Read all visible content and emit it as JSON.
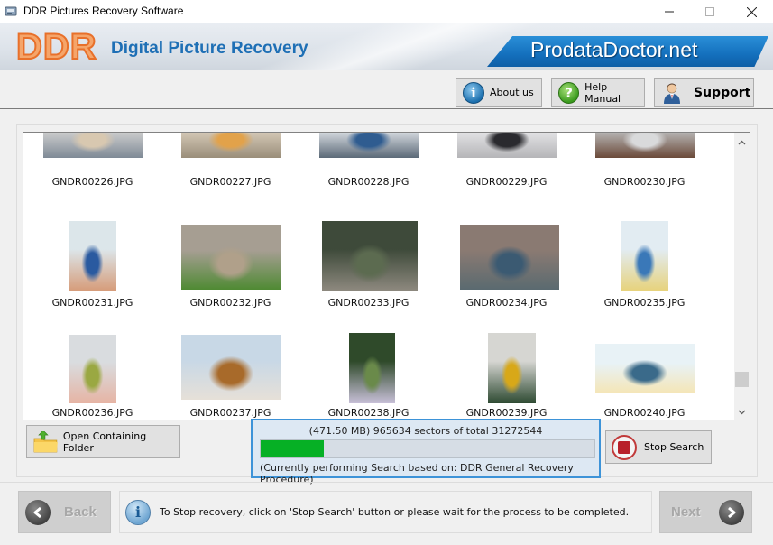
{
  "window": {
    "title": "DDR Pictures Recovery Software",
    "controls": {
      "minimize": "—",
      "maximize": "☐",
      "close": "✕"
    }
  },
  "banner": {
    "logo": "DDR",
    "product_name": "Digital Picture Recovery",
    "brand": "ProdataDoctor.net"
  },
  "toolbar": {
    "about_label": "About us",
    "about_icon": "i",
    "help_label": "Help Manual",
    "help_icon": "?",
    "support_label": "Support"
  },
  "gallery": {
    "items": [
      {
        "name": "GNDR00226.JPG",
        "colors": [
          "#cfcfcf",
          "#7f8a96",
          "#d8c8b0"
        ]
      },
      {
        "name": "GNDR00227.JPG",
        "colors": [
          "#d6cab8",
          "#9a8e7a",
          "#e2a24a"
        ]
      },
      {
        "name": "GNDR00228.JPG",
        "colors": [
          "#d9dde2",
          "#5c6a78",
          "#2f5c90"
        ]
      },
      {
        "name": "GNDR00229.JPG",
        "colors": [
          "#e4e4e6",
          "#b5b5b8",
          "#2a2a2e"
        ]
      },
      {
        "name": "GNDR00230.JPG",
        "colors": [
          "#b9b9b9",
          "#6b4a3a",
          "#d9dadb"
        ]
      },
      {
        "name": "GNDR00231.JPG",
        "colors": [
          "#dce6ea",
          "#d69b78",
          "#2a5aa0"
        ]
      },
      {
        "name": "GNDR00232.JPG",
        "colors": [
          "#a69e92",
          "#4f8a33",
          "#b0a08a"
        ]
      },
      {
        "name": "GNDR00233.JPG",
        "colors": [
          "#3e4a3a",
          "#8f8a80",
          "#5c6b50"
        ]
      },
      {
        "name": "GNDR00234.JPG",
        "colors": [
          "#8a7a72",
          "#5a6a70",
          "#3b5a72"
        ]
      },
      {
        "name": "GNDR00235.JPG",
        "colors": [
          "#e2ecf2",
          "#e7d27a",
          "#3a78b8"
        ]
      },
      {
        "name": "GNDR00236.JPG",
        "colors": [
          "#d9dcdf",
          "#e6b4a4",
          "#9aa842"
        ]
      },
      {
        "name": "GNDR00237.JPG",
        "colors": [
          "#c8d8e6",
          "#e6e0d8",
          "#a86a2a"
        ]
      },
      {
        "name": "GNDR00238.JPG",
        "colors": [
          "#2f4a2a",
          "#c8c0d8",
          "#6a8a4a"
        ]
      },
      {
        "name": "GNDR00239.JPG",
        "colors": [
          "#d6d6d2",
          "#2e4a32",
          "#d8a818"
        ]
      },
      {
        "name": "GNDR00240.JPG",
        "colors": [
          "#e8f2f6",
          "#f4e6b8",
          "#3a6a8a"
        ]
      }
    ],
    "scroll_position": 0.93
  },
  "actions": {
    "open_folder_label": "Open Containing Folder",
    "stop_search_label": "Stop Search"
  },
  "progress": {
    "sectors_text": "(471.50 MB) 965634  sectors  of  total 31272544",
    "size_mb": 471.5,
    "sectors_done": 965634,
    "sectors_total": 31272544,
    "bar_fill_fraction": 0.19,
    "bar_color": "#06b025",
    "status_text": "(Currently performing Search based on:  DDR General Recovery Procedure)"
  },
  "footer": {
    "back_label": "Back",
    "next_label": "Next",
    "info_message": "To Stop recovery, click on 'Stop Search' button or please wait for the process to be completed."
  }
}
